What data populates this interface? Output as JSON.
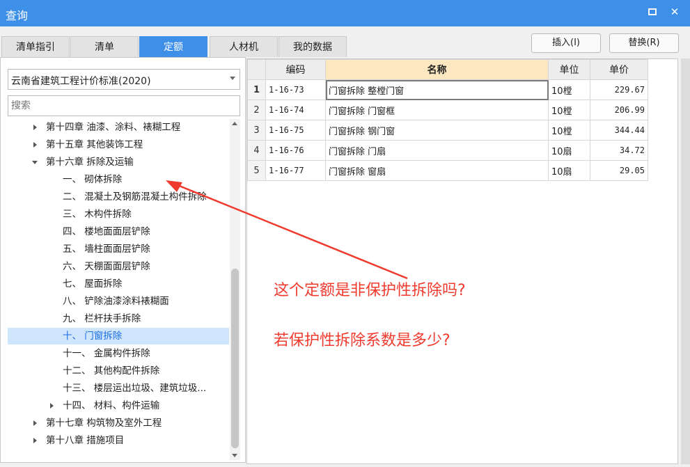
{
  "window": {
    "title": "查询"
  },
  "tabs": [
    {
      "label": "清单指引",
      "active": false
    },
    {
      "label": "清单",
      "active": false
    },
    {
      "label": "定额",
      "active": true
    },
    {
      "label": "人材机",
      "active": false
    },
    {
      "label": "我的数据",
      "active": false
    }
  ],
  "actions": {
    "insert_label": "插入(I)",
    "replace_label": "替换(R)"
  },
  "left_panel": {
    "standard_select": "云南省建筑工程计价标准(2020)",
    "search_placeholder": "搜索",
    "tree": [
      {
        "label": "第十四章 油漆、涂料、裱糊工程",
        "level": 0,
        "state": "collapsed"
      },
      {
        "label": "第十五章 其他装饰工程",
        "level": 0,
        "state": "collapsed"
      },
      {
        "label": "第十六章 拆除及运输",
        "level": 0,
        "state": "expanded"
      },
      {
        "label": "一、 砌体拆除",
        "level": 1,
        "state": "leaf"
      },
      {
        "label": "二、 混凝土及钢筋混凝土构件拆除",
        "level": 1,
        "state": "leaf"
      },
      {
        "label": "三、 木构件拆除",
        "level": 1,
        "state": "leaf"
      },
      {
        "label": "四、 楼地面面层铲除",
        "level": 1,
        "state": "leaf"
      },
      {
        "label": "五、 墙柱面面层铲除",
        "level": 1,
        "state": "leaf"
      },
      {
        "label": "六、 天棚面面层铲除",
        "level": 1,
        "state": "leaf"
      },
      {
        "label": "七、 屋面拆除",
        "level": 1,
        "state": "leaf"
      },
      {
        "label": "八、 铲除油漆涂料裱糊面",
        "level": 1,
        "state": "leaf"
      },
      {
        "label": "九、 栏杆扶手拆除",
        "level": 1,
        "state": "leaf"
      },
      {
        "label": "十、 门窗拆除",
        "level": 1,
        "state": "leaf",
        "selected": true
      },
      {
        "label": "十一、 金属构件拆除",
        "level": 1,
        "state": "leaf"
      },
      {
        "label": "十二、 其他构配件拆除",
        "level": 1,
        "state": "leaf"
      },
      {
        "label": "十三、 楼层运出垃圾、建筑垃圾...",
        "level": 1,
        "state": "leaf"
      },
      {
        "label": "十四、 材料、构件运输",
        "level": 1,
        "state": "collapsed"
      },
      {
        "label": "第十七章 构筑物及室外工程",
        "level": 0,
        "state": "collapsed"
      },
      {
        "label": "第十八章 措施项目",
        "level": 0,
        "state": "collapsed"
      }
    ]
  },
  "grid": {
    "headers": [
      "编码",
      "名称",
      "单位",
      "单价"
    ],
    "rows": [
      {
        "no": "1",
        "code": "1-16-73",
        "name": "门窗拆除 整樘门窗",
        "unit": "10樘",
        "price": "229.67"
      },
      {
        "no": "2",
        "code": "1-16-74",
        "name": "门窗拆除 门窗框",
        "unit": "10樘",
        "price": "206.99"
      },
      {
        "no": "3",
        "code": "1-16-75",
        "name": "门窗拆除 钢门窗",
        "unit": "10樘",
        "price": "344.44"
      },
      {
        "no": "4",
        "code": "1-16-76",
        "name": "门窗拆除 门扇",
        "unit": "10扇",
        "price": "34.72"
      },
      {
        "no": "5",
        "code": "1-16-77",
        "name": "门窗拆除 窗扇",
        "unit": "10扇",
        "price": "29.05"
      }
    ]
  },
  "annotations": {
    "question1": "这个定额是非保护性拆除吗?",
    "question2": "若保护性拆除系数是多少?",
    "color": "#f03a2e"
  }
}
